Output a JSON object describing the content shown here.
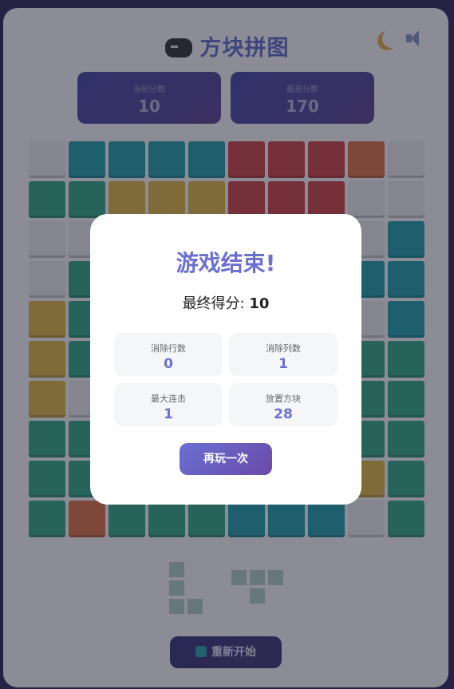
{
  "header": {
    "title": "方块拼图"
  },
  "scores": {
    "current": {
      "label": "当前分数",
      "value": "10"
    },
    "best": {
      "label": "最高分数",
      "value": "170"
    }
  },
  "board": {
    "rows": [
      [
        "e",
        "t",
        "t",
        "t",
        "t",
        "r",
        "r",
        "r",
        "o",
        "e"
      ],
      [
        "g",
        "g",
        "y",
        "y",
        "y",
        "r",
        "r",
        "r",
        "e",
        "e"
      ],
      [
        "e",
        "e",
        "e",
        "e",
        "e",
        "e",
        "e",
        "e",
        "e",
        "t"
      ],
      [
        "e",
        "g",
        "e",
        "e",
        "e",
        "e",
        "e",
        "e",
        "t",
        "t"
      ],
      [
        "y",
        "g",
        "e",
        "e",
        "e",
        "e",
        "e",
        "e",
        "e",
        "t"
      ],
      [
        "y",
        "g",
        "e",
        "e",
        "e",
        "e",
        "e",
        "e",
        "g",
        "g"
      ],
      [
        "y",
        "e",
        "e",
        "e",
        "e",
        "e",
        "e",
        "e",
        "g",
        "g"
      ],
      [
        "g",
        "g",
        "e",
        "e",
        "e",
        "e",
        "e",
        "e",
        "g",
        "g"
      ],
      [
        "g",
        "g",
        "e",
        "e",
        "e",
        "e",
        "e",
        "e",
        "y",
        "g"
      ],
      [
        "g",
        "o",
        "g",
        "g",
        "g",
        "t",
        "t",
        "t",
        "e",
        "g"
      ]
    ]
  },
  "colors": {
    "accent": "#6a6fd3",
    "teal": "#1a9aa3",
    "red": "#c63c3c",
    "orange": "#d76b3c",
    "yellow": "#d9b23a",
    "green": "#2ba37c"
  },
  "modal": {
    "title": "游戏结束!",
    "final_label": "最终得分: ",
    "final_value": "10",
    "stats": [
      {
        "label": "消除行数",
        "value": "0"
      },
      {
        "label": "消除列数",
        "value": "1"
      },
      {
        "label": "最大连击",
        "value": "1"
      },
      {
        "label": "放置方块",
        "value": "28"
      }
    ],
    "play_again": "再玩一次"
  },
  "footer": {
    "restart": "重新开始",
    "restart_icon": "refresh-icon"
  },
  "icons": {
    "title_icon": "gamepad-icon",
    "theme": "moon-icon",
    "sound": "speaker-icon"
  }
}
